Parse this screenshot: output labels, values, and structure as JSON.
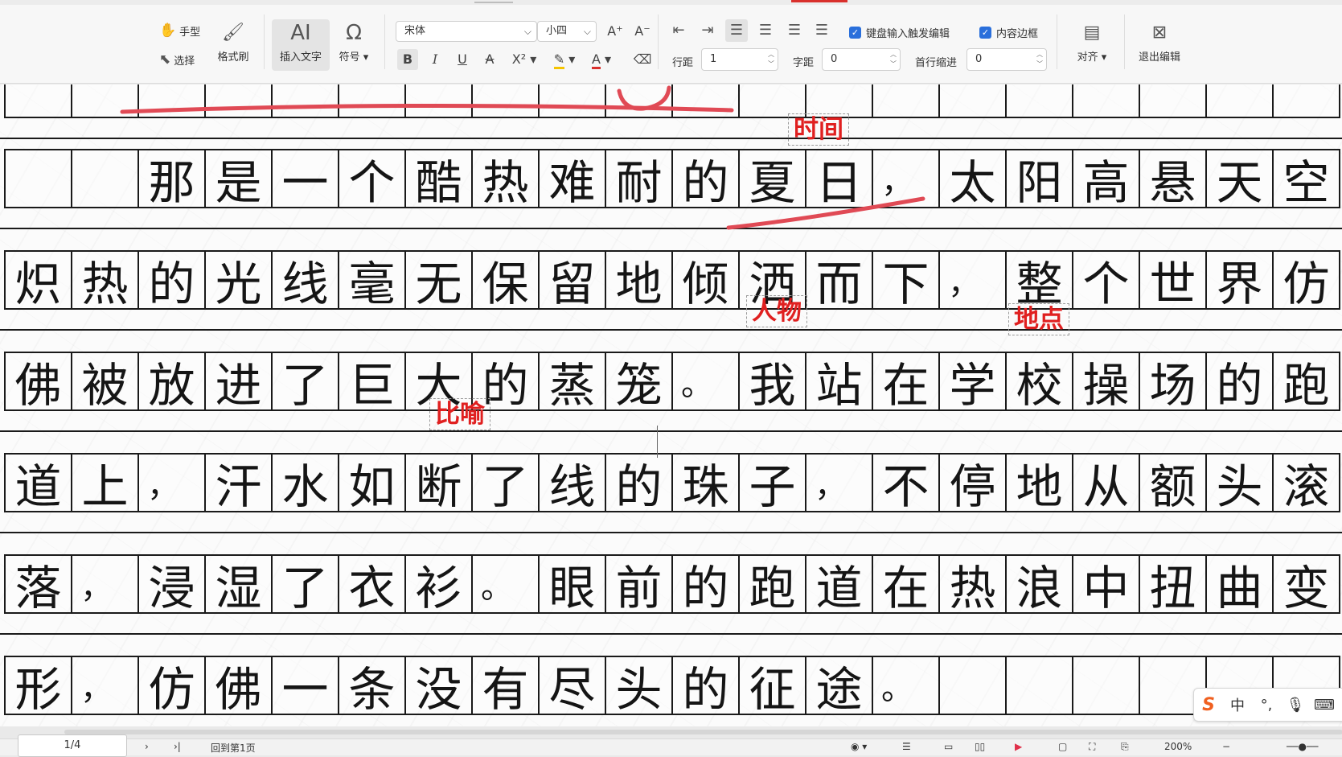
{
  "toolbar": {
    "hand_tool": "手型",
    "select_tool": "选择",
    "format_painter": "格式刷",
    "insert_text": "插入文字",
    "symbol": "符号",
    "font_name": "宋体",
    "font_size": "小四",
    "line_spacing_label": "行距",
    "line_spacing_value": "1",
    "char_spacing_label": "字距",
    "char_spacing_value": "0",
    "first_indent_label": "首行缩进",
    "first_indent_value": "0",
    "keyboard_trigger_label": "键盘输入触发编辑",
    "content_border_label": "内容边框",
    "align_label": "对齐",
    "exit_edit_label": "退出编辑",
    "icons": {
      "hand": "hand-icon",
      "select": "cursor-icon",
      "format_painter": "brush-icon",
      "insert_text": "text-insert-icon",
      "symbol": "omega-icon",
      "bold": "bold-icon",
      "italic": "italic-icon",
      "underline": "underline-icon",
      "strike": "strikethrough-icon",
      "superscript": "superscript-icon",
      "highlight": "highlight-icon",
      "font_color": "font-color-icon",
      "eraser": "eraser-icon",
      "exit": "close-box-icon"
    },
    "colors": {
      "accent_blue": "#2a6fdb",
      "font_color_red": "#d9302c",
      "highlight_yellow": "#f5c400"
    }
  },
  "document": {
    "rows": [
      {
        "chars": [
          "",
          "",
          "",
          "",
          "",
          "",
          "",
          "",
          "",
          "",
          "",
          "",
          "",
          "",
          "",
          "",
          "",
          "",
          "",
          ""
        ],
        "partial": true
      },
      {
        "chars": [
          "",
          "",
          "那",
          "是",
          "一",
          "个",
          "酷",
          "热",
          "难",
          "耐",
          "的",
          "夏",
          "日",
          "，",
          "太",
          "阳",
          "高",
          "悬",
          "天",
          "空"
        ]
      },
      {
        "chars": [
          "炽",
          "热",
          "的",
          "光",
          "线",
          "毫",
          "无",
          "保",
          "留",
          "地",
          "倾",
          "洒",
          "而",
          "下",
          "，",
          "整",
          "个",
          "世",
          "界",
          "仿"
        ]
      },
      {
        "chars": [
          "佛",
          "被",
          "放",
          "进",
          "了",
          "巨",
          "大",
          "的",
          "蒸",
          "笼",
          "。",
          "我",
          "站",
          "在",
          "学",
          "校",
          "操",
          "场",
          "的",
          "跑"
        ]
      },
      {
        "chars": [
          "道",
          "上",
          "，",
          "汗",
          "水",
          "如",
          "断",
          "了",
          "线",
          "的",
          "珠",
          "子",
          "，",
          "不",
          "停",
          "地",
          "从",
          "额",
          "头",
          "滚"
        ]
      },
      {
        "chars": [
          "落",
          "，",
          "浸",
          "湿",
          "了",
          "衣",
          "衫",
          "。",
          "眼",
          "前",
          "的",
          "跑",
          "道",
          "在",
          "热",
          "浪",
          "中",
          "扭",
          "曲",
          "变"
        ]
      },
      {
        "chars": [
          "形",
          "，",
          "仿",
          "佛",
          "一",
          "条",
          "没",
          "有",
          "尽",
          "头",
          "的",
          "征",
          "途",
          "。",
          "",
          "",
          "",
          "",
          "",
          ""
        ]
      }
    ],
    "annotations": {
      "time": "时间",
      "character": "人物",
      "place": "地点",
      "simile": "比喻"
    },
    "annotation_color": "#e02020",
    "ink_color": "#e04a55"
  },
  "ime": {
    "logo": "S",
    "lang": "中",
    "punct": "°,",
    "mic": "mic-icon",
    "keyboard": "keyboard-icon"
  },
  "statusbar": {
    "page_indicator": "1/4",
    "back_to_first": "回到第1页",
    "zoom": "200%"
  }
}
